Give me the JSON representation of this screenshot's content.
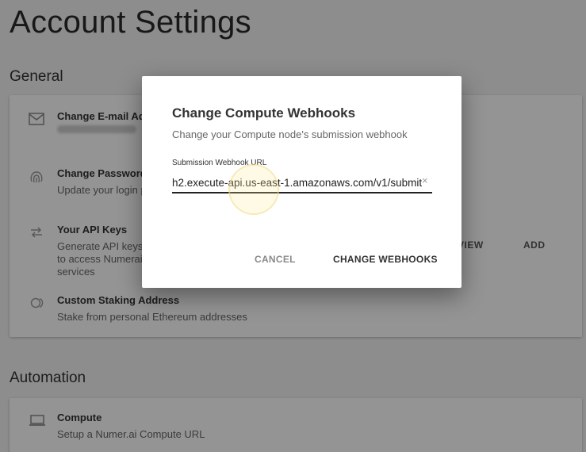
{
  "page": {
    "title": "Account Settings"
  },
  "general": {
    "heading": "General",
    "items": [
      {
        "icon": "mail-icon",
        "title": "Change E-mail Address",
        "subtitle": ""
      },
      {
        "icon": "fingerprint-icon",
        "title": "Change Password",
        "subtitle": "Update your login password"
      },
      {
        "icon": "swap-icon",
        "title": "Your API Keys",
        "subtitle": "Generate API keys to access Numerai services",
        "actions": [
          "VIEW",
          "ADD"
        ]
      },
      {
        "icon": "eth-icon",
        "title": "Custom Staking Address",
        "subtitle": "Stake from personal Ethereum addresses"
      }
    ]
  },
  "automation": {
    "heading": "Automation",
    "items": [
      {
        "icon": "laptop-icon",
        "title": "Compute",
        "subtitle": "Setup a Numer.ai Compute URL"
      }
    ]
  },
  "dialog": {
    "title": "Change Compute Webhooks",
    "subtitle": "Change your Compute node's submission webhook",
    "field_label": "Submission Webhook URL",
    "field_value": "h2.execute-api.us-east-1.amazonaws.com/v1/submit",
    "clear_glyph": "×",
    "cancel_label": "CANCEL",
    "confirm_label": "CHANGE WEBHOOKS"
  }
}
